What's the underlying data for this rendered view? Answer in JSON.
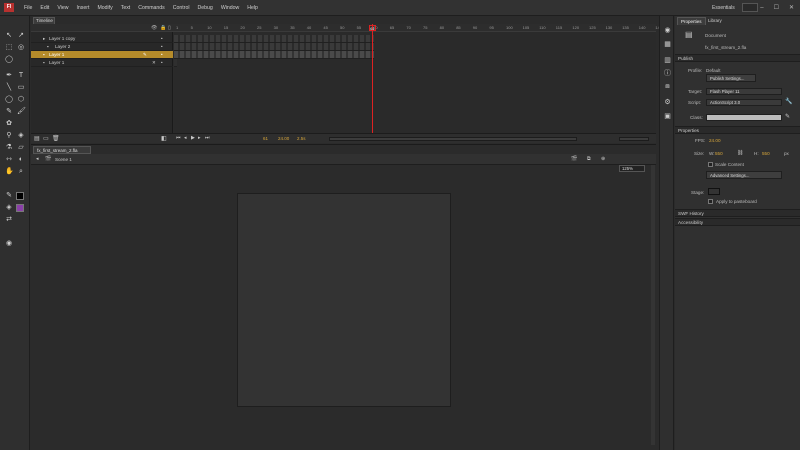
{
  "app": {
    "logo": "Fl"
  },
  "menu": [
    "File",
    "Edit",
    "View",
    "Insert",
    "Modify",
    "Text",
    "Commands",
    "Control",
    "Debug",
    "Window",
    "Help"
  ],
  "workspace": "Essentials",
  "timeline": {
    "tab": "Timeline",
    "layers": [
      {
        "name": "Layer 1 copy"
      },
      {
        "name": "Layer 2"
      },
      {
        "name": "Layer 1"
      },
      {
        "name": "Layer 1"
      }
    ],
    "ruler": [
      "1",
      "5",
      "10",
      "15",
      "20",
      "25",
      "30",
      "35",
      "40",
      "45",
      "50",
      "55",
      "60",
      "65",
      "70",
      "75",
      "80",
      "85",
      "90",
      "95",
      "100",
      "105",
      "110",
      "115",
      "120",
      "125",
      "130",
      "135",
      "140",
      "145"
    ],
    "current_frame": "61",
    "fps": "24.00",
    "footer_frame": "61",
    "footer_time": "2.5s"
  },
  "document": {
    "tab": "fx_first_stream_2.fla",
    "scene": "Scene 1",
    "zoom": "125%"
  },
  "properties": {
    "tabs": [
      "Properties",
      "Library"
    ],
    "doc_title": "Document",
    "doc_file": "fx_first_stream_2.fla",
    "publish": {
      "heading": "Publish",
      "profile_label": "Profile:",
      "profile_value": "Default",
      "publish_settings": "Publish Settings...",
      "target_label": "Target:",
      "target_value": "Flash Player 11",
      "script_label": "Script:",
      "script_value": "ActionScript 3.0",
      "class_label": "Class:"
    },
    "props": {
      "heading": "Properties",
      "fps_label": "FPS:",
      "fps_value": "24.00",
      "size_label": "Size:",
      "w_label": "W:",
      "w_value": "550",
      "h_label": "H:",
      "h_value": "550",
      "unit": "px",
      "scale_content": "Scale Content",
      "advanced_settings": "Advanced Settings...",
      "stage_label": "Stage:",
      "apply_pasteboard": "Apply to pasteboard"
    },
    "swf_history": "SWF History",
    "accessibility": "Accessibility"
  },
  "colors": {
    "stroke": "#000000",
    "fill": "#8a3fa8",
    "selected_layer": "#b58b2a",
    "playhead": "#dd2222"
  }
}
